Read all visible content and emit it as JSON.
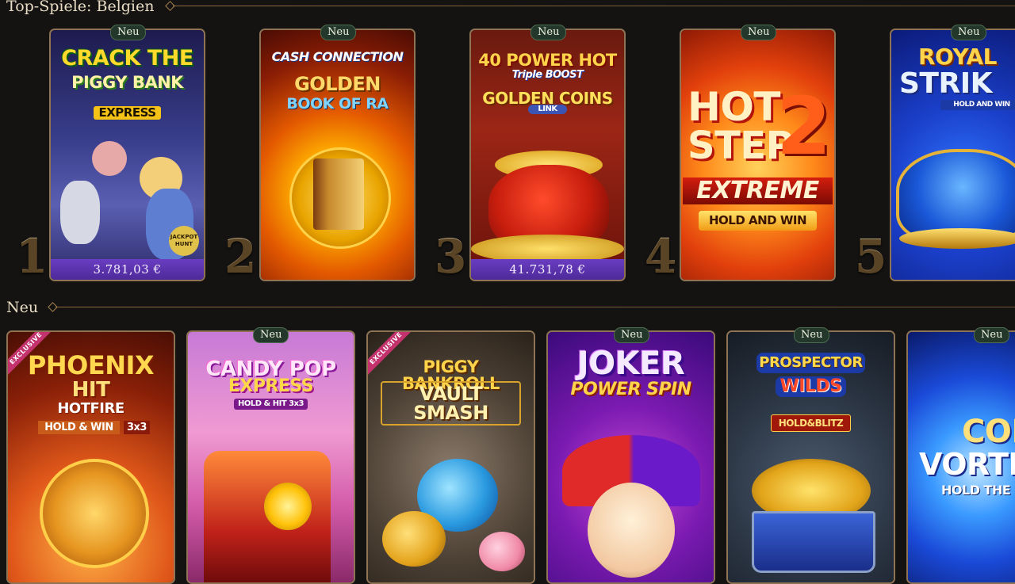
{
  "sections": {
    "top": {
      "title": "Top-Spiele: Belgien"
    },
    "new": {
      "title": "Neu"
    }
  },
  "badge_new_label": "Neu",
  "top_games": [
    {
      "rank": "1",
      "title_lines": [
        "CRACK THE",
        "PIGGY BANK",
        "EXPRESS"
      ],
      "corner_logo": "JACKPOT HUNT",
      "jackpot": "3.781,03 €"
    },
    {
      "rank": "2",
      "title_lines": [
        "CASH CONNECTION",
        "GOLDEN",
        "BOOK OF RA"
      ]
    },
    {
      "rank": "3",
      "title_lines": [
        "40 POWER HOT",
        "Triple BOOST",
        "GOLDEN COINS",
        "LINK"
      ],
      "jackpot": "41.731,78 €"
    },
    {
      "rank": "4",
      "title_lines": [
        "HOT",
        "STEP",
        "2",
        "EXTREME",
        "HOLD AND WIN"
      ]
    },
    {
      "rank": "5",
      "title_lines": [
        "ROYAL",
        "STRIK",
        "HOLD AND WIN"
      ]
    }
  ],
  "new_games": [
    {
      "ribbon": "EXCLUSIVE",
      "title_lines": [
        "PHOENIX",
        "HIT",
        "HOTFIRE",
        "HOLD & WIN",
        "3x3"
      ]
    },
    {
      "title_lines": [
        "CANDY POP",
        "EXPRESS",
        "HOLD & HIT 3x3"
      ]
    },
    {
      "ribbon": "EXCLUSIVE",
      "title_lines": [
        "PIGGY BANKROLL",
        "VAULT SMASH"
      ]
    },
    {
      "title_lines": [
        "JOKER",
        "POWER SPIN"
      ]
    },
    {
      "title_lines": [
        "PROSPECTOR",
        "WILDS",
        "HOLD&BLITZ"
      ]
    },
    {
      "title_lines": [
        "COI",
        "VORTE",
        "HOLD THE"
      ]
    }
  ],
  "colors": {
    "background": "#141312",
    "card_border": "#8e7355",
    "jackpot_bar": "#5a32aa",
    "badge_bg": "#23382a",
    "rank_gold": "#c2a174"
  }
}
